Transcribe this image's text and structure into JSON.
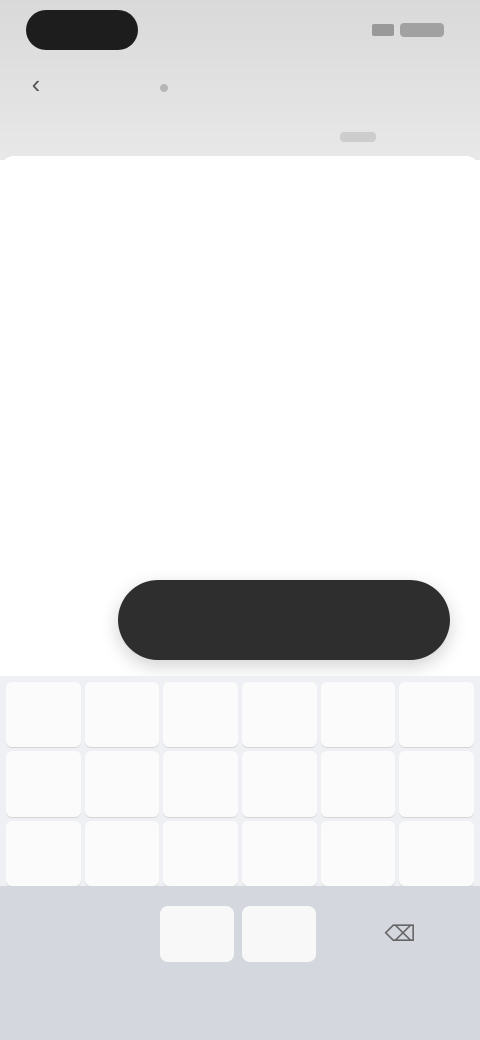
{
  "status": {
    "time": ""
  },
  "nav": {
    "back_icon": "‹",
    "title": ""
  },
  "sheet": {
    "title": "",
    "description": "",
    "code": "",
    "hint": "",
    "confirm_label": ""
  },
  "keyboard": {
    "keys": [
      "",
      "",
      "",
      "",
      "",
      "",
      "",
      "",
      "",
      "",
      "",
      "",
      "",
      "",
      "",
      "",
      "",
      ""
    ],
    "bottom_left_label": "",
    "bottom_mid_label": "",
    "delete_icon": "⌫"
  },
  "colors": {
    "accent": "#2e2e2e",
    "keyboard_bg": "#eef0f3"
  }
}
